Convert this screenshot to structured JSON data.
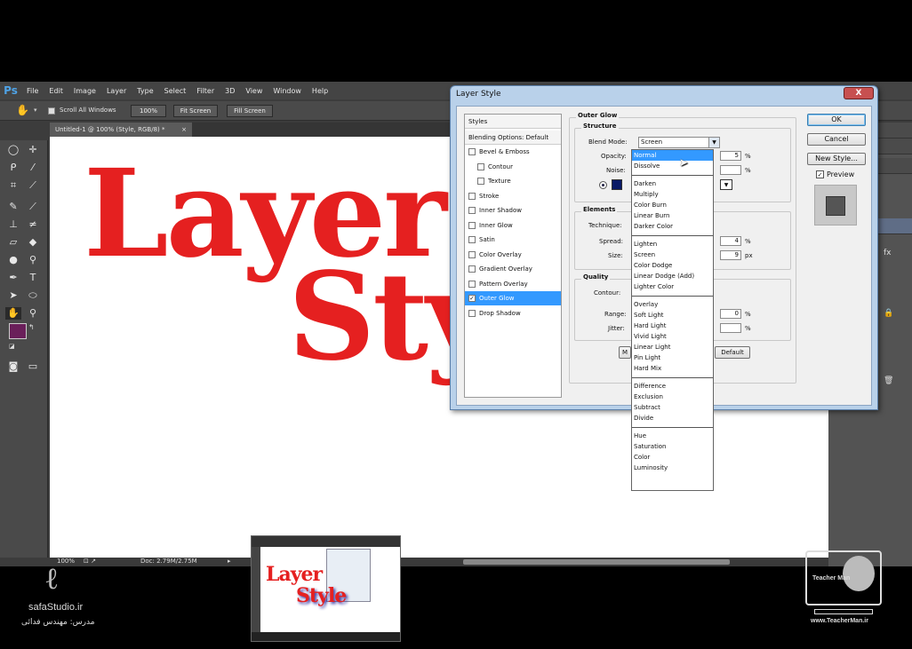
{
  "app": {
    "logo": "Ps"
  },
  "menu": [
    "File",
    "Edit",
    "Image",
    "Layer",
    "Type",
    "Select",
    "Filter",
    "3D",
    "View",
    "Window",
    "Help"
  ],
  "options_bar": {
    "scroll_all_windows": "Scroll All Windows",
    "zoom_100": "100%",
    "fit_screen": "Fit Screen",
    "fill_screen": "Fill Screen"
  },
  "document": {
    "tab_title": "Untitled-1 @ 100% (Style, RGB/8) *",
    "line1": "Layer",
    "line2": "Style",
    "text_color": "#e52020"
  },
  "status": {
    "zoom": "100%",
    "doc": "Doc: 2.79M/2.75M"
  },
  "colors": {
    "foreground": "#6a1f5a",
    "background": "#ffffff"
  },
  "dialog": {
    "title": "Layer Style",
    "close": "X",
    "styles_header": "Styles",
    "blending_options": "Blending Options: Default",
    "styles": [
      {
        "label": "Bevel & Emboss",
        "checked": false,
        "indent": false
      },
      {
        "label": "Contour",
        "checked": false,
        "indent": true
      },
      {
        "label": "Texture",
        "checked": false,
        "indent": true
      },
      {
        "label": "Stroke",
        "checked": false,
        "indent": false
      },
      {
        "label": "Inner Shadow",
        "checked": false,
        "indent": false
      },
      {
        "label": "Inner Glow",
        "checked": false,
        "indent": false
      },
      {
        "label": "Satin",
        "checked": false,
        "indent": false
      },
      {
        "label": "Color Overlay",
        "checked": false,
        "indent": false
      },
      {
        "label": "Gradient Overlay",
        "checked": false,
        "indent": false
      },
      {
        "label": "Pattern Overlay",
        "checked": false,
        "indent": false
      },
      {
        "label": "Outer Glow",
        "checked": true,
        "indent": false,
        "selected": true
      },
      {
        "label": "Drop Shadow",
        "checked": false,
        "indent": false
      }
    ],
    "outer_glow": {
      "title": "Outer Glow",
      "structure": "Structure",
      "blend_mode_label": "Blend Mode:",
      "blend_mode_value": "Screen",
      "opacity_label": "Opacity:",
      "opacity_value": "5",
      "noise_label": "Noise:",
      "percent": "%",
      "glow_color": "#0a1a66",
      "elements": "Elements",
      "technique_label": "Technique:",
      "spread_label": "Spread:",
      "spread_value": "4",
      "size_label": "Size:",
      "size_value": "9",
      "px": "px",
      "quality": "Quality",
      "contour_label": "Contour:",
      "range_label": "Range:",
      "range_value": "0",
      "jitter_label": "Jitter:",
      "default_button": "Default",
      "make_default_stub": "M"
    },
    "buttons": {
      "ok": "OK",
      "cancel": "Cancel",
      "new_style": "New Style...",
      "preview": "Preview"
    }
  },
  "blend_dropdown": {
    "groups": [
      [
        "Normal",
        "Dissolve"
      ],
      [
        "Darken",
        "Multiply",
        "Color Burn",
        "Linear Burn",
        "Darker Color"
      ],
      [
        "Lighten",
        "Screen",
        "Color Dodge",
        "Linear Dodge (Add)",
        "Lighter Color"
      ],
      [
        "Overlay",
        "Soft Light",
        "Hard Light",
        "Vivid Light",
        "Linear Light",
        "Pin Light",
        "Hard Mix"
      ],
      [
        "Difference",
        "Exclusion",
        "Subtract",
        "Divide"
      ],
      [
        "Hue",
        "Saturation",
        "Color",
        "Luminosity"
      ]
    ],
    "highlighted": "Normal"
  },
  "watermarks": {
    "left_site": "safaStudio.ir",
    "left_credit": "مدرس: مهندس فدائی",
    "right_site": "www.TeacherMan.ir",
    "right_brand": "Teacher Man"
  }
}
